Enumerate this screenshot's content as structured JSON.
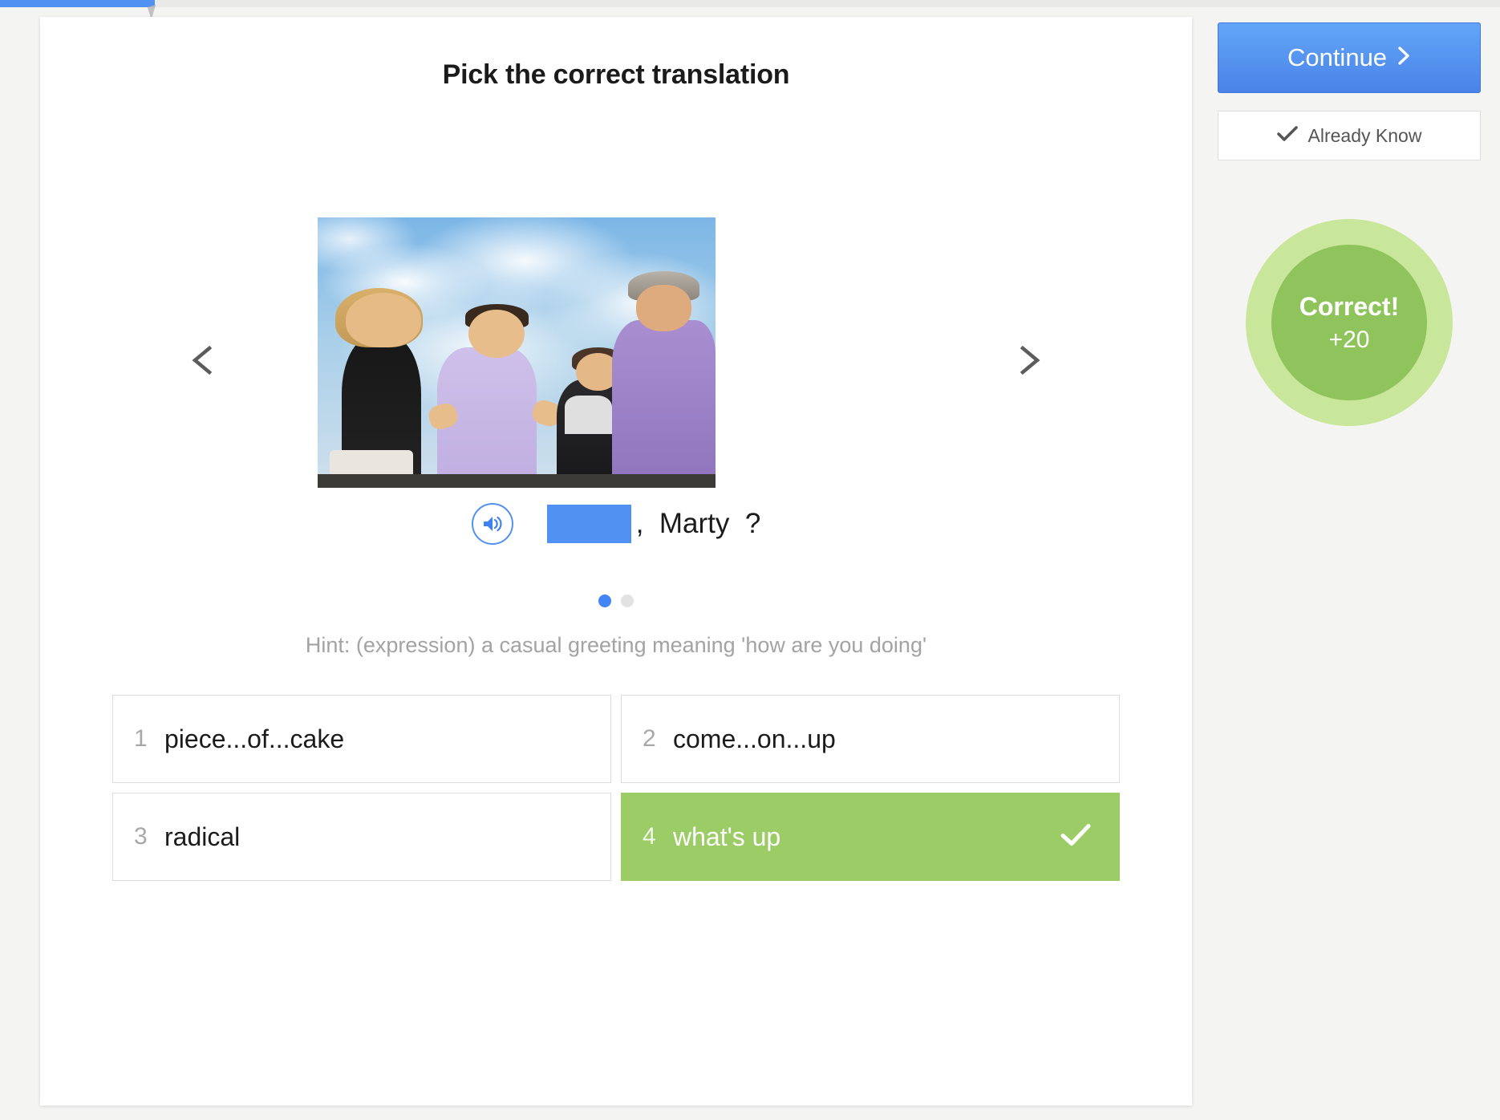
{
  "progress": {
    "percent": 10
  },
  "card": {
    "title": "Pick the correct translation",
    "image_alt": "four people talking outdoors under a cloudy sky",
    "nav": {
      "prev_icon": "chevron-left-icon",
      "next_icon": "chevron-right-icon"
    },
    "sentence": {
      "audio_icon": "speaker-icon",
      "blank": "",
      "text": ",  Marty  ?"
    },
    "pagination": {
      "total": 2,
      "active_index": 0
    },
    "hint": "Hint: (expression) a casual greeting meaning 'how are you doing'",
    "options": [
      {
        "number": "1",
        "label": "piece...of...cake",
        "correct": false
      },
      {
        "number": "2",
        "label": "come...on...up",
        "correct": false
      },
      {
        "number": "3",
        "label": "radical",
        "correct": false
      },
      {
        "number": "4",
        "label": "what's up",
        "correct": true
      }
    ]
  },
  "rail": {
    "continue_label": "Continue",
    "continue_icon": "chevron-right-icon",
    "already_know_label": "Already Know",
    "already_know_icon": "check-icon",
    "score": {
      "title": "Correct!",
      "points": "+20"
    }
  },
  "colors": {
    "accent_blue": "#5191f2",
    "correct_green": "#9ccc65",
    "score_inner_green": "#8fc45c",
    "score_outer_green": "#c9e79a",
    "page_bg": "#f4f4f3"
  }
}
